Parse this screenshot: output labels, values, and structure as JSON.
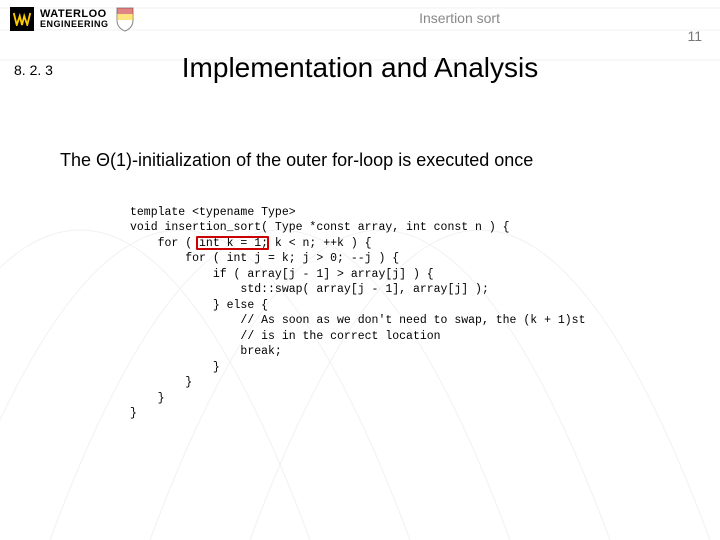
{
  "header": {
    "logo_line1": "WATERLOO",
    "logo_line2": "ENGINEERING",
    "topic": "Insertion sort",
    "page_number": "11",
    "section_number": "8. 2. 3"
  },
  "title": "Implementation and Analysis",
  "sentence": {
    "prefix": "The ",
    "theta": "Θ",
    "bigo_arg": "(1)",
    "rest": "-initialization of the outer for-loop is executed once"
  },
  "code": {
    "l01": "template <typename Type>",
    "l02": "void insertion_sort( Type *const array, int const n ) {",
    "l03": "    for ( int k = 1; k < n; ++k ) {",
    "l04": "        for ( int j = k; j > 0; --j ) {",
    "l05": "            if ( array[j - 1] > array[j] ) {",
    "l06": "                std::swap( array[j - 1], array[j] );",
    "l07": "            } else {",
    "l08": "                // As soon as we don't need to swap, the (k + 1)st",
    "l09": "                // is in the correct location",
    "l10": "                break;",
    "l11": "            }",
    "l12": "        }",
    "l13": "    }",
    "l14": "}"
  },
  "highlight": {
    "line": 3,
    "text": "int k = 1;"
  }
}
